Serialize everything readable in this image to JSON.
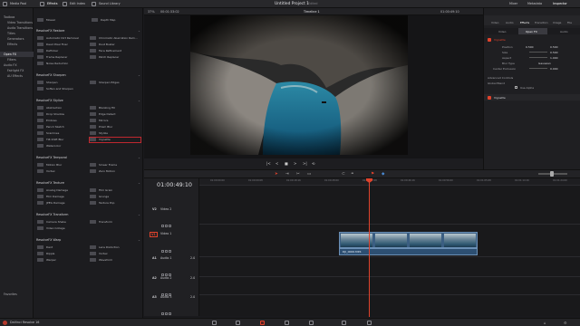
{
  "topbar": {
    "items": [
      "Media Pool",
      "Effects",
      "Edit Index",
      "Sound Library"
    ],
    "right_items": [
      "Mixer",
      "Metadata",
      "Inspector"
    ],
    "title": "Untitled Project 1",
    "title_status": "Edited"
  },
  "left_tree": {
    "items": [
      "Toolbox",
      "Video Transitions",
      "Audio Transitions",
      "Titles",
      "Generators",
      "Effects",
      "Open FX",
      "Filters",
      "Audio FX",
      "Fairlight FX",
      "AU Effects"
    ],
    "bottom": "Favorites"
  },
  "fx_panel": {
    "top_items": [
      "Mosaic",
      "Depth Map"
    ],
    "sections": [
      {
        "title": "ResolveFX Restore",
        "items": [
          [
            "Automatic Dirt Removal",
            "Chromatic Aberration Rem..."
          ],
          [
            "Dead Pixel Fixer",
            "Dust Buster"
          ],
          [
            "Deflicker",
            "Face Refinement"
          ],
          [
            "Frame Replacer",
            "Patch Replacer"
          ],
          [
            "Noise Reduction",
            ""
          ]
        ]
      },
      {
        "title": "ResolveFX Sharpen",
        "items": [
          [
            "Sharpen",
            "Sharpen Edges"
          ],
          [
            "Soften and Sharpen",
            ""
          ]
        ]
      },
      {
        "title": "ResolveFX Stylize",
        "items": [
          [
            "Abstraction",
            "Blanking Fill"
          ],
          [
            "Drop Shadow",
            "Edge Detect"
          ],
          [
            "Emboss",
            "Mirrors"
          ],
          [
            "Pencil Sketch",
            "Prism Blur"
          ],
          [
            "Scanlines",
            "Stylize"
          ],
          [
            "Tilt-Shift Blur",
            "Vignette"
          ],
          [
            "Watercolor",
            ""
          ]
        ]
      },
      {
        "title": "ResolveFX Temporal",
        "items": [
          [
            "Motion Blur",
            "Smear Frame"
          ],
          [
            "Vortex",
            "Zero Motion"
          ]
        ]
      },
      {
        "title": "ResolveFX Texture",
        "items": [
          [
            "Analog Damage",
            "Film Grain"
          ],
          [
            "Film Damage",
            "Grunge"
          ],
          [
            "JPEG Damage",
            "Texture Pop"
          ]
        ]
      },
      {
        "title": "ResolveFX Transform",
        "items": [
          [
            "Camera Shake",
            "Transform"
          ],
          [
            "Video Collage",
            ""
          ]
        ]
      },
      {
        "title": "ResolveFX Warp",
        "items": [
          [
            "Dent",
            "Lens Distortion"
          ],
          [
            "Ripple",
            "Vortex"
          ],
          [
            "Warper",
            "Waveform"
          ]
        ]
      }
    ],
    "selected": "Vignette"
  },
  "viewer_bar": {
    "zoom": "37%",
    "timecode": "00:01:33:02",
    "timeline_name": "Timeline 1",
    "tc_right": "01:00:49:10",
    "clip_name": "DJI_0006.MP4"
  },
  "transport": {
    "timecode": "01:00:49:10",
    "buttons": [
      "|<",
      "<",
      "■",
      ">",
      ">|",
      "⟲"
    ]
  },
  "ruler": {
    "ticks": [
      "01:00:00:00",
      "01:00:09:08",
      "01:00:18:16",
      "01:00:28:00",
      "01:00:37:08",
      "01:00:46:16",
      "01:00:56:00",
      "01:01:05:08",
      "01:01:14:16",
      "01:01:24:00"
    ]
  },
  "tracks": {
    "video": [
      {
        "code": "V2",
        "name": "Video 2"
      },
      {
        "code": "V1",
        "name": "Video 1"
      }
    ],
    "audio": [
      {
        "code": "A1",
        "name": "Audio 1",
        "num": "2.0"
      },
      {
        "code": "A2",
        "name": "Audio 2",
        "num": "2.0"
      },
      {
        "code": "A3",
        "name": "Audio 3",
        "num": "2.0"
      }
    ],
    "clip_name": "DJI_0006.MP4"
  },
  "inspector": {
    "tabs": [
      "Video",
      "Audio",
      "Effects",
      "Transition",
      "Image",
      "File"
    ],
    "subtabs": [
      "Video",
      "Open FX",
      "Audio"
    ],
    "group": "Vignette",
    "rows": [
      {
        "label": "Position",
        "v1": "0.500",
        "v2": "0.500"
      },
      {
        "label": "Size",
        "v1": "",
        "v2": "0.500"
      },
      {
        "label": "Aspect",
        "v1": "",
        "v2": "1.000"
      },
      {
        "label": "Blur Type",
        "v1": "",
        "v2": "Gaussian"
      },
      {
        "label": "Center Exclusion",
        "v1": "",
        "v2": "0.000"
      }
    ],
    "advanced": "Advanced Controls",
    "blend": "Global Blend",
    "use_alpha": "Use Alpha",
    "footer": "Vignette"
  },
  "bottom": {
    "app": "DaVinci Resolve 16"
  },
  "colors": {
    "accent": "#e0432c",
    "clip": "#3b5e82"
  }
}
